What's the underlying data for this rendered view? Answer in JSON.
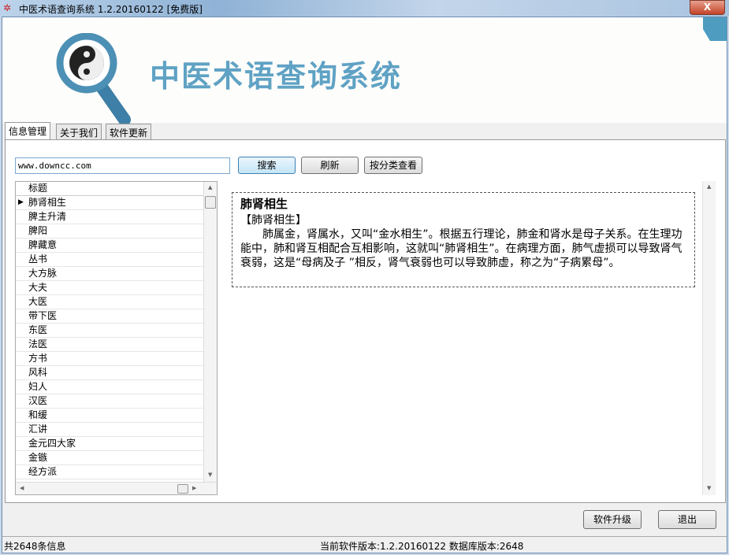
{
  "window": {
    "title": "中医术语查询系统 1.2.20160122 [免费版]",
    "close_label": "X"
  },
  "header": {
    "app_title": "中医术语查询系统",
    "logo_icon": "yin-yang-magnifier-icon",
    "accent": "#5fa2c4"
  },
  "tabs": [
    {
      "label": "信息管理",
      "active": true
    },
    {
      "label": "关于我们"
    },
    {
      "label": "软件更新"
    }
  ],
  "search": {
    "value": "www.downcc.com",
    "search_label": "搜索",
    "refresh_label": "刷新",
    "category_label": "按分类查看"
  },
  "list": {
    "header": "标题",
    "items": [
      "肺肾相生",
      "脾主升清",
      "脾阳",
      "脾藏意",
      "丛书",
      "大方脉",
      "大夫",
      "大医",
      "带下医",
      "东医",
      "法医",
      "方书",
      "风科",
      "妇人",
      "汉医",
      "和缓",
      "汇讲",
      "金元四大家",
      "金镞",
      "经方派"
    ],
    "selected": 0
  },
  "detail": {
    "title": "肺肾相生",
    "body": "【肺肾相生】\n　　肺属金，肾属水，又叫“金水相生”。根据五行理论，肺金和肾水是母子关系。在生理功能中，肺和肾互相配合互相影响，这就叫“肺肾相生”。在病理方面，肺气虚损可以导致肾气衰弱，这是“母病及子 ”相反，肾气衰弱也可以导致肺虚，称之为“子病累母”。"
  },
  "footer": {
    "upgrade_label": "软件升级",
    "exit_label": "退出"
  },
  "status": {
    "count": "共2648条信息",
    "version": "当前软件版本:1.2.20160122 数据库版本:2648"
  }
}
